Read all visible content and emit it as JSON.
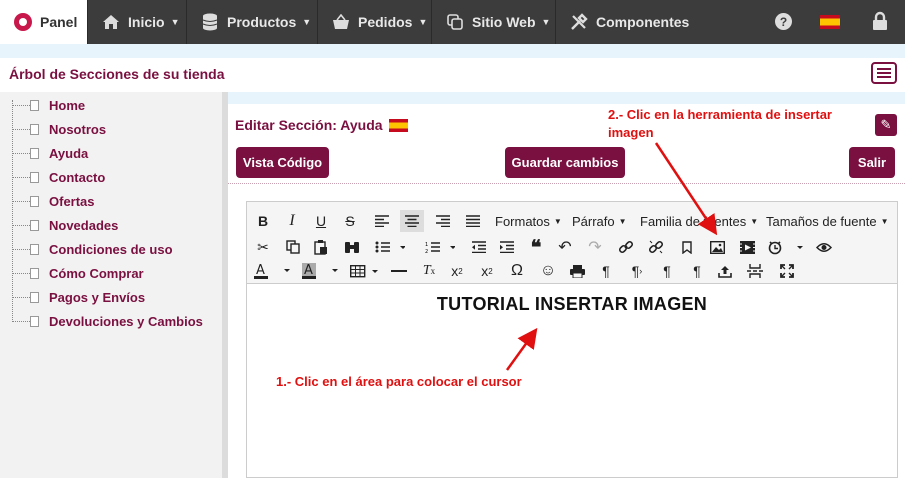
{
  "nav": {
    "panel": "Panel",
    "items": [
      {
        "label": "Inicio"
      },
      {
        "label": "Productos"
      },
      {
        "label": "Pedidos"
      },
      {
        "label": "Sitio Web"
      },
      {
        "label": "Componentes"
      }
    ]
  },
  "sidebar": {
    "title": "Árbol de Secciones de su tienda",
    "items": [
      "Home",
      "Nosotros",
      "Ayuda",
      "Contacto",
      "Ofertas",
      "Novedades",
      "Condiciones de uso",
      "Cómo Comprar",
      "Pagos y Envíos",
      "Devoluciones y Cambios"
    ]
  },
  "main": {
    "title": "Editar Sección: Ayuda",
    "btn_code": "Vista Código",
    "btn_save": "Guardar cambios",
    "btn_exit": "Salir"
  },
  "toolbar": {
    "formatos": "Formatos",
    "parrafo": "Párrafo",
    "familia": "Familia de fuentes",
    "tamanos": "Tamaños de fuente"
  },
  "editor": {
    "content_title": "TUTORIAL INSERTAR IMAGEN"
  },
  "annotations": {
    "step1": "1.- Clic en el área para colocar el cursor",
    "step2_line1": "2.- Clic en la herramienta de insertar",
    "step2_line2": "imagen"
  },
  "colors": {
    "brand": "#7a1040",
    "annotation": "#e01010",
    "nav_bg": "#3c3c3c"
  }
}
